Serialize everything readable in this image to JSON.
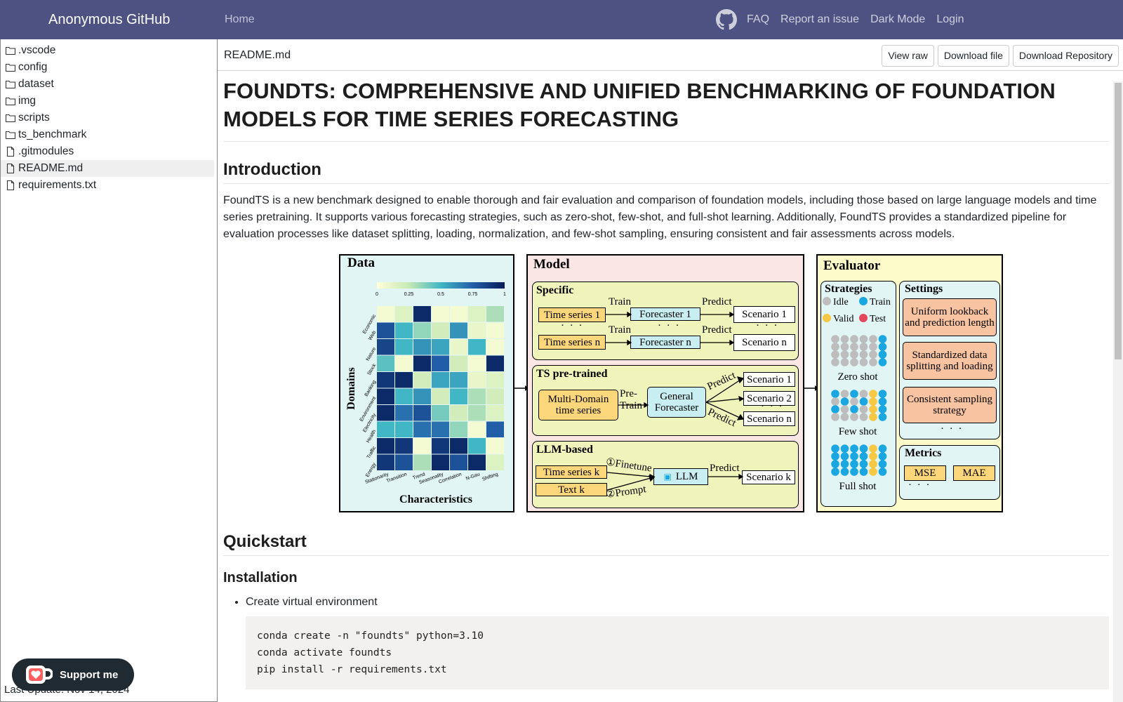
{
  "navbar": {
    "brand": "Anonymous GitHub",
    "home": "Home",
    "links": [
      "FAQ",
      "Report an issue",
      "Dark Mode",
      "Login"
    ],
    "github_icon": "github-icon"
  },
  "sidebar": {
    "items": [
      {
        "label": ".vscode",
        "type": "folder"
      },
      {
        "label": "config",
        "type": "folder"
      },
      {
        "label": "dataset",
        "type": "folder"
      },
      {
        "label": "img",
        "type": "folder"
      },
      {
        "label": "scripts",
        "type": "folder"
      },
      {
        "label": "ts_benchmark",
        "type": "folder"
      },
      {
        "label": ".gitmodules",
        "type": "file"
      },
      {
        "label": "README.md",
        "type": "file",
        "selected": true
      },
      {
        "label": "requirements.txt",
        "type": "file"
      }
    ],
    "last_update": "Last Update: Nov 14, 2024",
    "support_label": "Support me"
  },
  "file": {
    "name": "README.md",
    "buttons": {
      "view_raw": "View raw",
      "download_file": "Download file",
      "download_repo": "Download Repository"
    }
  },
  "readme": {
    "title": "FOUNDTS: COMPREHENSIVE AND UNIFIED BENCHMARKING OF FOUNDATION MODELS FOR TIME SERIES FORECASTING",
    "introduction_heading": "Introduction",
    "intro_text": "FoundTS is a new benchmark designed to enable thorough and fair evaluation and comparison of foundation models, including those based on large language models and time series pretraining. It supports various forecasting strategies, such as zero-shot, few-shot, and full-shot learning. Additionally, FoundTS provides a standardized pipeline for evaluation processes like dataset splitting, loading, normalization, and few-shot sampling, ensuring consistent and fair assessments across models.",
    "quickstart_heading": "Quickstart",
    "installation_heading": "Installation",
    "steps": [
      "Create virtual environment"
    ],
    "code": "conda create -n \"foundts\" python=3.10\nconda activate foundts\npip install -r requirements.txt"
  },
  "figure": {
    "data_panel": {
      "title": "Data",
      "ylabel": "Domains",
      "xlabel": "Characteristics",
      "colorbar_ticks": [
        "0",
        "0.25",
        "0.5",
        "0.75",
        "1"
      ],
      "domains": [
        "Economic",
        "Web",
        "Nature",
        "Stock",
        "Banking",
        "Environment",
        "Electricity",
        "Health",
        "Traffic",
        "Energy"
      ],
      "characteristics": [
        "Stationarity",
        "Transition",
        "Trend",
        "Seasonality",
        "Correlation",
        "N-Gau",
        "Shifting"
      ],
      "heatmap": [
        [
          0.05,
          0.15,
          0.95,
          0.05,
          0.05,
          0.15,
          0.3
        ],
        [
          0.8,
          0.5,
          0.35,
          0.2,
          0.6,
          0.1,
          0.05
        ],
        [
          0.85,
          0.5,
          0.6,
          0.55,
          0.1,
          0.5,
          0.05
        ],
        [
          0.45,
          0.05,
          0.95,
          0.75,
          0.2,
          0.05,
          0.95
        ],
        [
          0.9,
          0.95,
          0.2,
          0.55,
          0.55,
          0.1,
          0.15
        ],
        [
          0.95,
          0.5,
          0.6,
          0.2,
          0.5,
          0.3,
          0.2
        ],
        [
          0.95,
          0.7,
          0.8,
          0.4,
          0.2,
          0.3,
          0.15
        ],
        [
          0.5,
          0.5,
          0.7,
          0.7,
          0.35,
          0.05,
          0.75
        ],
        [
          0.95,
          0.9,
          0.05,
          0.9,
          0.95,
          0.5,
          0.05
        ],
        [
          0.9,
          0.8,
          0.3,
          0.95,
          0.8,
          0.95,
          0.15
        ]
      ]
    },
    "model_panel": {
      "title": "Model",
      "specific": {
        "title": "Specific",
        "rows": [
          {
            "input": "Time series 1",
            "train": "Train",
            "model": "Forecaster 1",
            "predict": "Predict",
            "output": "Scenario 1"
          },
          {
            "input": "Time series n",
            "train": "Train",
            "model": "Forecaster n",
            "predict": "Predict",
            "output": "Scenario n"
          }
        ],
        "ellipsis": "· · ·"
      },
      "pretrained": {
        "title": "TS pre-trained",
        "input": "Multi-Domain time series",
        "arrow_label": "Pre-Train",
        "model": "General Forecaster",
        "predict": "Predict",
        "outputs": [
          "Scenario 1",
          "Scenario 2",
          "Scenario n"
        ],
        "ellipsis": "· · ·"
      },
      "llm": {
        "title": "LLM-based",
        "inputs": [
          "Time series k",
          "Text k"
        ],
        "steps": [
          "①Finetune",
          "②Prompt"
        ],
        "model": "LLM",
        "predict": "Predict",
        "output": "Scenario k"
      }
    },
    "evaluator_panel": {
      "title": "Evaluator",
      "strategies_title": "Strategies",
      "legend": [
        "Idle",
        "Train",
        "Valid",
        "Test"
      ],
      "shots": [
        "Zero shot",
        "Few shot",
        "Full shot"
      ],
      "settings_title": "Settings",
      "settings": [
        "Uniform lookback and prediction length",
        "Standardized data splitting and loading",
        "Consistent sampling strategy"
      ],
      "metrics_title": "Metrics",
      "metrics": [
        "MSE",
        "MAE"
      ],
      "ellipsis": "· · ·",
      "colors": {
        "idle": "#bdbdbd",
        "train": "#1aa6e0",
        "valid": "#f6c843",
        "test": "#e3485a"
      }
    }
  }
}
